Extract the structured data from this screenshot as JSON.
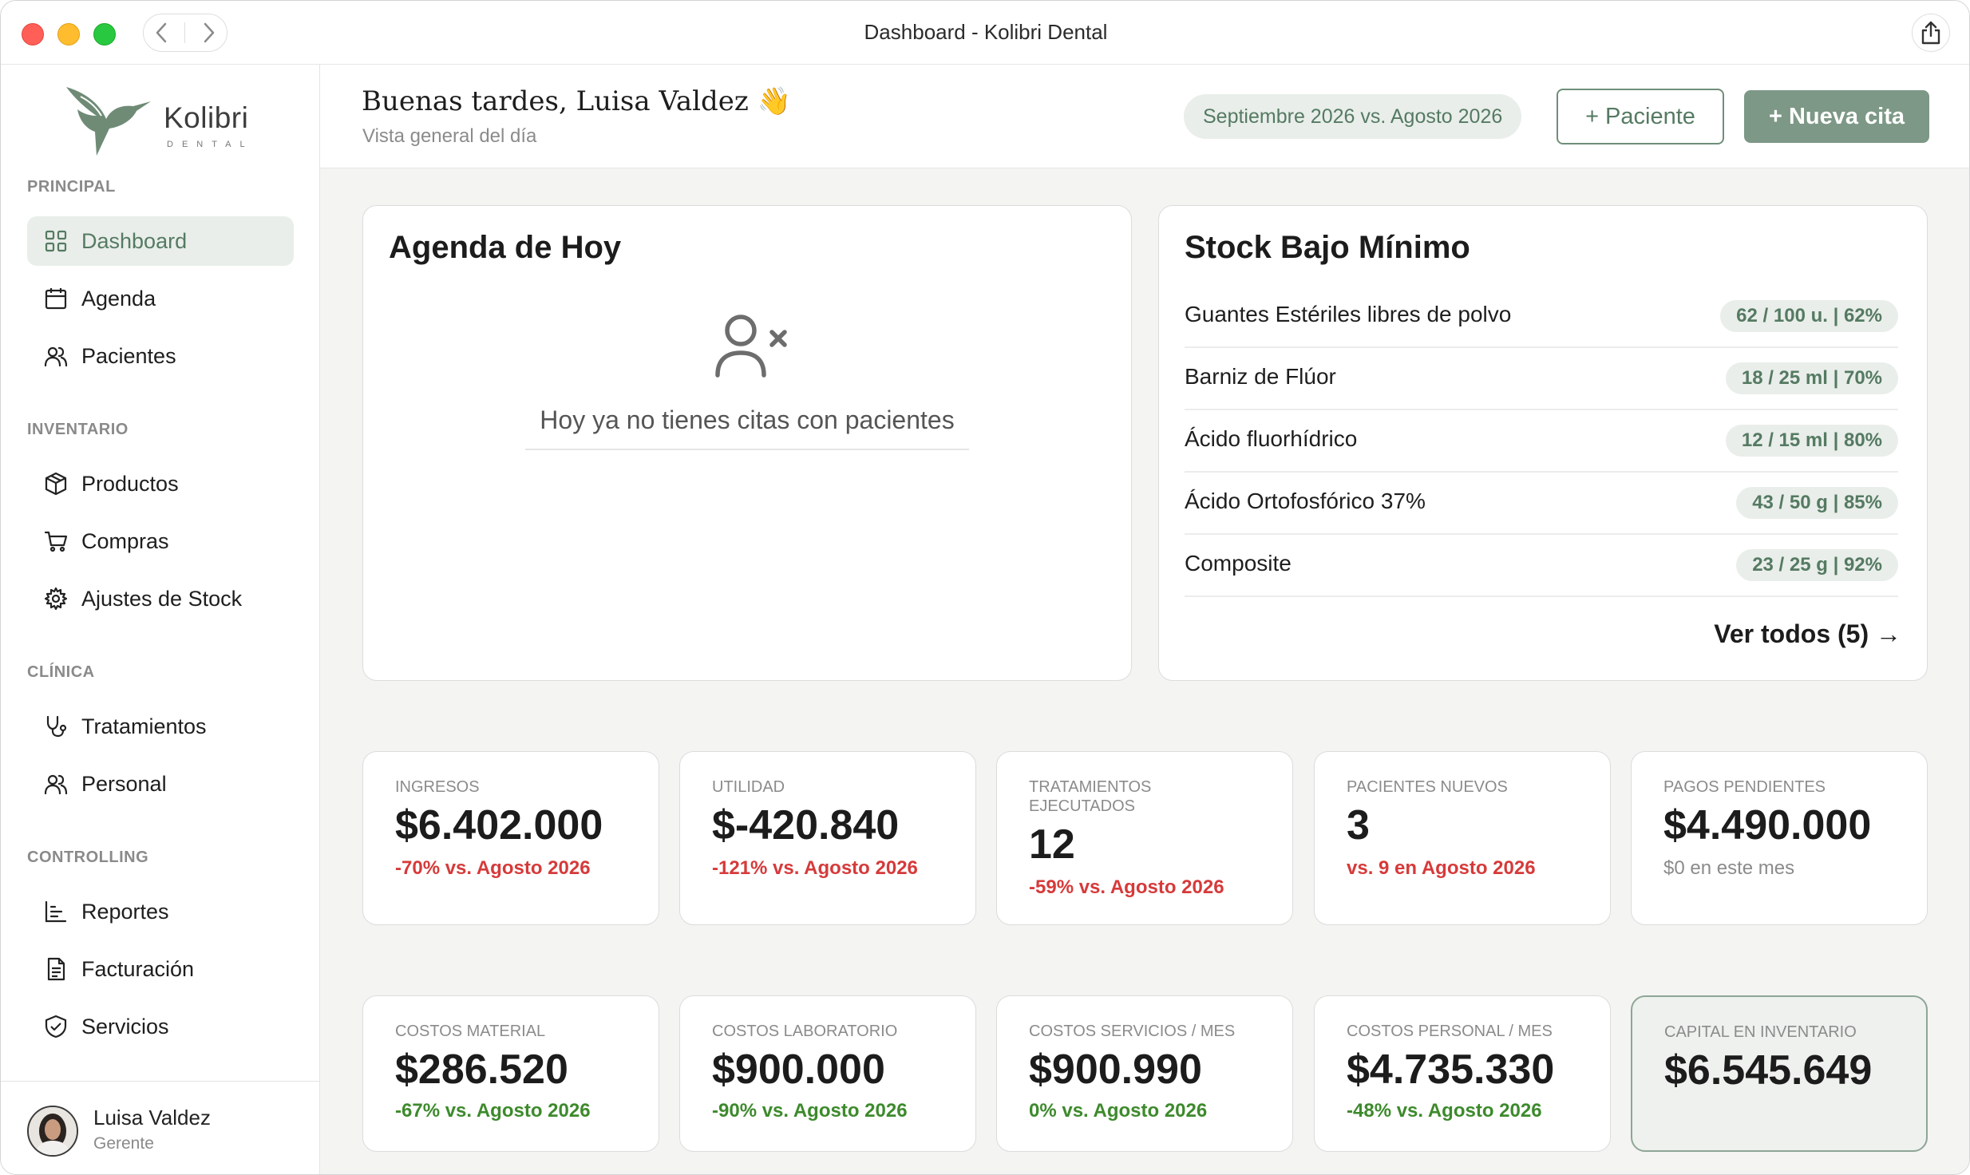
{
  "window": {
    "title": "Dashboard - Kolibri Dental"
  },
  "brand": {
    "name": "Kolibri",
    "sub": "DENTAL"
  },
  "sidebar": {
    "sections": [
      {
        "label": "PRINCIPAL"
      },
      {
        "label": "INVENTARIO"
      },
      {
        "label": "CLÍNICA"
      },
      {
        "label": "CONTROLLING"
      }
    ],
    "items": [
      {
        "label": "Dashboard",
        "icon": "grid-icon",
        "active": true
      },
      {
        "label": "Agenda",
        "icon": "calendar-icon"
      },
      {
        "label": "Pacientes",
        "icon": "users-icon"
      },
      {
        "label": "Productos",
        "icon": "box-icon"
      },
      {
        "label": "Compras",
        "icon": "cart-icon"
      },
      {
        "label": "Ajustes de Stock",
        "icon": "gear-icon"
      },
      {
        "label": "Tratamientos",
        "icon": "stethoscope-icon"
      },
      {
        "label": "Personal",
        "icon": "users-icon"
      },
      {
        "label": "Reportes",
        "icon": "chart-icon"
      },
      {
        "label": "Facturación",
        "icon": "document-icon"
      },
      {
        "label": "Servicios",
        "icon": "shield-icon"
      }
    ],
    "user": {
      "name": "Luisa Valdez",
      "role": "Gerente"
    }
  },
  "header": {
    "greeting": "Buenas tardes, Luisa Valdez 👋",
    "subtitle": "Vista general del día",
    "period": "Septiembre 2026 vs. Agosto 2026",
    "add_patient": "+ Paciente",
    "new_appointment": "+ Nueva cita"
  },
  "agenda": {
    "title": "Agenda de Hoy",
    "empty_text": "Hoy ya no tienes citas con pacientes"
  },
  "stock": {
    "title": "Stock Bajo Mínimo",
    "rows": [
      {
        "name": "Guantes Estériles libres de polvo",
        "badge": "62 / 100 u. | 62%"
      },
      {
        "name": "Barniz de Flúor",
        "badge": "18 / 25 ml | 70%"
      },
      {
        "name": "Ácido fluorhídrico",
        "badge": "12 / 15 ml | 80%"
      },
      {
        "name": "Ácido Ortofosfórico 37%",
        "badge": "43 / 50 g | 85%"
      },
      {
        "name": "Composite",
        "badge": "23 / 25 g | 92%"
      }
    ],
    "view_all": "Ver todos (5) →"
  },
  "kpis_row1": [
    {
      "label": "INGRESOS",
      "value": "$6.402.000",
      "compare": "-70% vs. Agosto 2026",
      "tone": "red"
    },
    {
      "label": "UTILIDAD",
      "value": "$-420.840",
      "compare": "-121% vs. Agosto 2026",
      "tone": "red"
    },
    {
      "label": "TRATAMIENTOS EJECUTADOS",
      "value": "12",
      "compare": "-59% vs. Agosto 2026",
      "tone": "red"
    },
    {
      "label": "PACIENTES NUEVOS",
      "value": "3",
      "compare": "vs. 9 en Agosto 2026",
      "tone": "red"
    },
    {
      "label": "PAGOS PENDIENTES",
      "value": "$4.490.000",
      "compare": "$0 en este mes",
      "tone": "grey"
    }
  ],
  "kpis_row2": [
    {
      "label": "COSTOS MATERIAL",
      "value": "$286.520",
      "compare": "-67% vs. Agosto 2026",
      "tone": "green"
    },
    {
      "label": "COSTOS LABORATORIO",
      "value": "$900.000",
      "compare": "-90% vs. Agosto 2026",
      "tone": "green"
    },
    {
      "label": "COSTOS SERVICIOS / MES",
      "value": "$900.990",
      "compare": "0% vs. Agosto 2026",
      "tone": "green"
    },
    {
      "label": "COSTOS PERSONAL / MES",
      "value": "$4.735.330",
      "compare": "-48% vs. Agosto 2026",
      "tone": "green"
    },
    {
      "label": "CAPITAL EN INVENTARIO",
      "value": "$6.545.649",
      "compare": "",
      "tone": "grey"
    }
  ],
  "colors": {
    "accent": "#7d9886",
    "accent_text": "#557a62",
    "accent_bg": "#e9eeea",
    "negative": "#d63a3a",
    "positive": "#3d8a2c"
  }
}
